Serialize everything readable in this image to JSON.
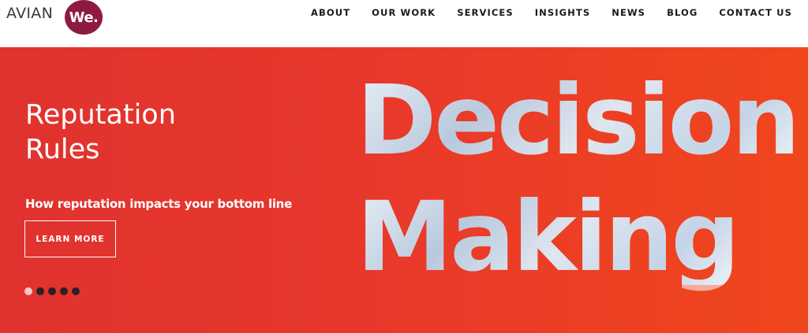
{
  "brand": {
    "name": "AVIAN",
    "badge": "We."
  },
  "nav": {
    "items": [
      "ABOUT",
      "OUR WORK",
      "SERVICES",
      "INSIGHTS",
      "NEWS",
      "BLOG",
      "CONTACT US"
    ]
  },
  "hero": {
    "title_line1": "Reputation",
    "title_line2": "Rules",
    "subtitle": "How reputation impacts your bottom line",
    "cta_label": "LEARN MORE",
    "big_line1": "Decision",
    "big_line2": "Making",
    "slides_total": 5,
    "active_slide": 1
  },
  "colors": {
    "hero_start": "#e0322f",
    "hero_end": "#f0461d",
    "badge": "#8e1b3f"
  }
}
